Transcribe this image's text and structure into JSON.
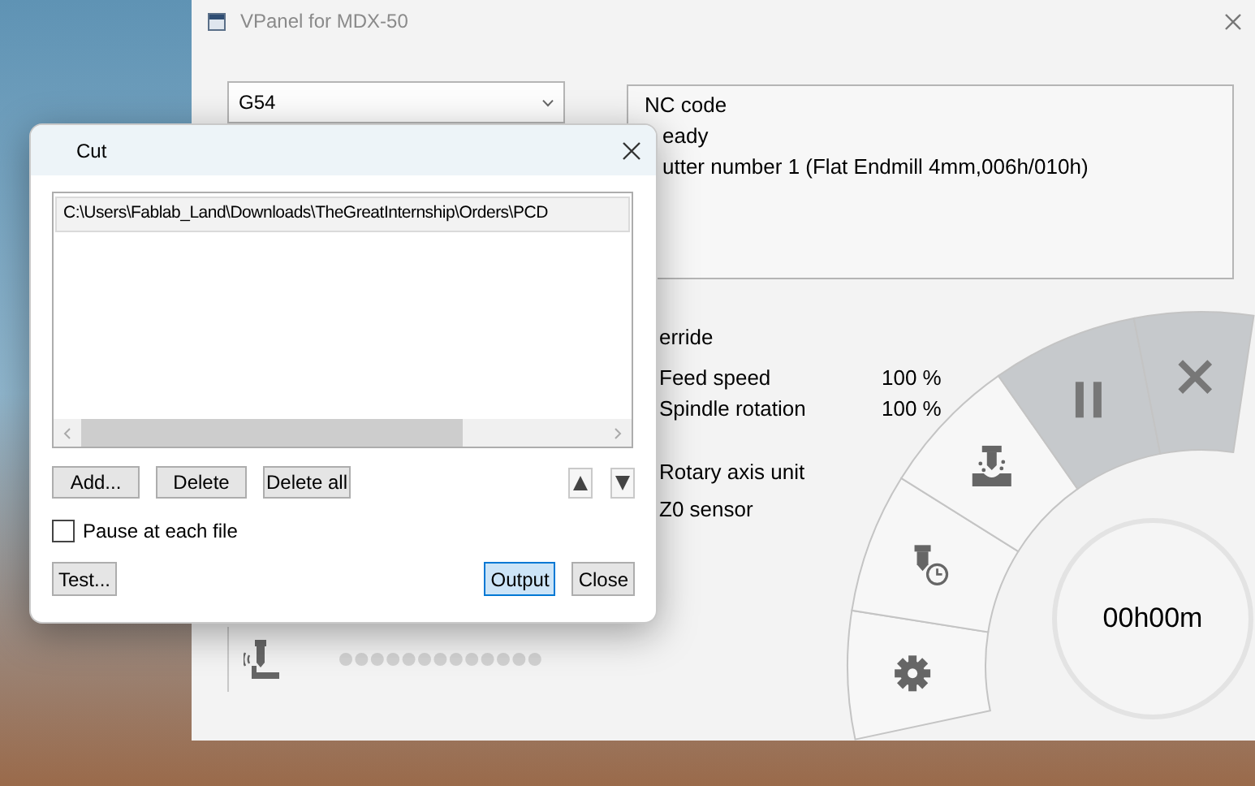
{
  "main_window": {
    "title": "VPanel for MDX-50",
    "coordinate_system": {
      "value": "G54"
    },
    "nc_code": {
      "heading": "NC code",
      "lines": [
        "eady",
        "utter number 1 (Flat Endmill 4mm,006h/010h)"
      ]
    },
    "override": {
      "heading": "erride",
      "rows": [
        {
          "label": "Feed speed",
          "value": "100 %"
        },
        {
          "label": "Spindle rotation",
          "value": "100 %"
        }
      ]
    },
    "options": [
      "Rotary axis unit",
      "Z0 sensor"
    ],
    "dial": {
      "segments": [
        {
          "kind": "settings",
          "highlighted": false
        },
        {
          "kind": "spindle-timer",
          "highlighted": false
        },
        {
          "kind": "cut",
          "highlighted": false
        },
        {
          "kind": "pause",
          "highlighted": true
        },
        {
          "kind": "stop",
          "highlighted": true
        }
      ],
      "time": "00h00m"
    }
  },
  "cut_dialog": {
    "title": "Cut",
    "files": [
      {
        "path": "C:\\Users\\Fablab_Land\\Downloads\\TheGreatInternship\\Orders\\PCD",
        "selected": true
      }
    ],
    "list_buttons": [
      "Add...",
      "Delete",
      "Delete all"
    ],
    "pause_at_each_file": {
      "label": "Pause at each file",
      "checked": false
    },
    "footer_buttons": [
      {
        "label": "Test...",
        "default": false
      },
      {
        "label": "Output",
        "default": true
      },
      {
        "label": "Close",
        "default": false
      }
    ]
  }
}
